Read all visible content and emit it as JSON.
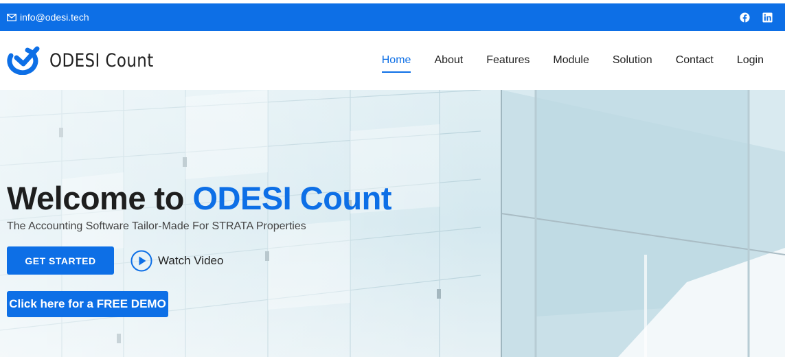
{
  "topbar": {
    "email": "info@odesi.tech",
    "mail_icon": "mail-icon",
    "socials": [
      "facebook-icon",
      "linkedin-icon"
    ]
  },
  "header": {
    "brand_name": "ODESI Count",
    "nav": [
      {
        "label": "Home",
        "active": true
      },
      {
        "label": "About",
        "active": false
      },
      {
        "label": "Features",
        "active": false
      },
      {
        "label": "Module",
        "active": false
      },
      {
        "label": "Solution",
        "active": false
      },
      {
        "label": "Contact",
        "active": false
      },
      {
        "label": "Login",
        "active": false
      }
    ]
  },
  "hero": {
    "title_prefix": "Welcome to ",
    "title_accent": "ODESI Count",
    "subtitle": "The Accounting Software Tailor-Made For STRATA Properties",
    "get_started": "GET STARTED",
    "watch_video": "Watch Video",
    "demo_button": "Click here for a FREE DEMO"
  },
  "colors": {
    "accent": "#0d6fe6",
    "text_dark": "#1e1e1e"
  }
}
